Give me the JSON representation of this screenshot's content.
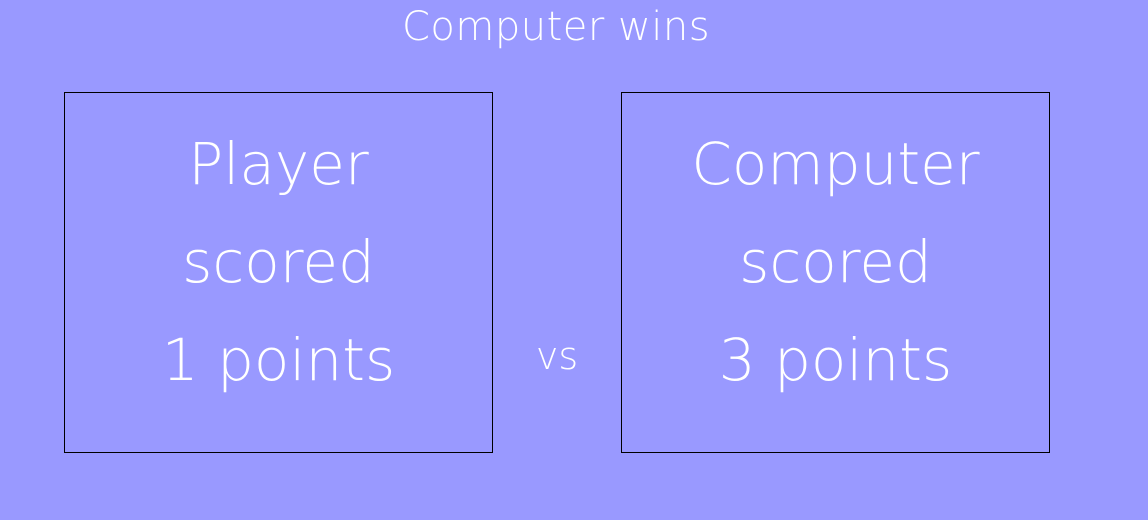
{
  "result": {
    "title": "Computer wins"
  },
  "player": {
    "line1": "Player",
    "line2": "scored",
    "line3": "1 points",
    "points": 1
  },
  "versus": {
    "label": "vs"
  },
  "computer": {
    "line1": "Computer",
    "line2": "scored",
    "line3": "3 points",
    "points": 3
  },
  "colors": {
    "background": "#9999ff",
    "text": "#ffffff",
    "box_border": "#000000"
  }
}
